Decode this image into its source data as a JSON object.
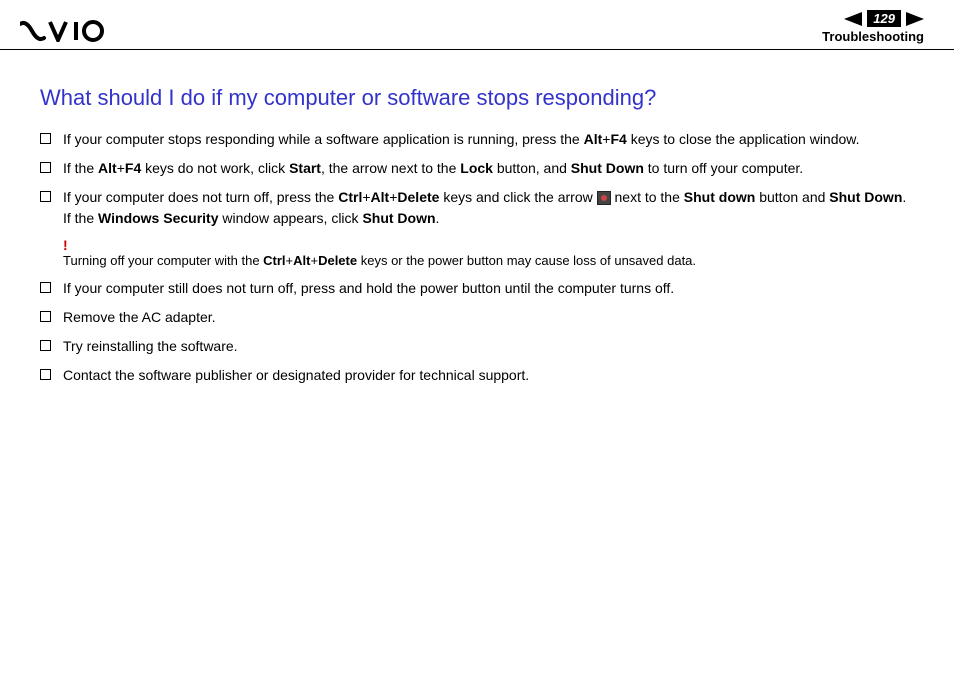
{
  "header": {
    "page_number": "129",
    "section": "Troubleshooting"
  },
  "title": "What should I do if my computer or software stops responding?",
  "bullets": [
    {
      "parts": [
        {
          "t": "If your computer stops responding while a software application is running, press the "
        },
        {
          "t": "Alt",
          "b": true
        },
        {
          "t": "+"
        },
        {
          "t": "F4",
          "b": true
        },
        {
          "t": " keys to close the application window."
        }
      ]
    },
    {
      "parts": [
        {
          "t": "If the "
        },
        {
          "t": "Alt",
          "b": true
        },
        {
          "t": "+"
        },
        {
          "t": "F4",
          "b": true
        },
        {
          "t": " keys do not work, click "
        },
        {
          "t": "Start",
          "b": true
        },
        {
          "t": ", the arrow next to the "
        },
        {
          "t": "Lock",
          "b": true
        },
        {
          "t": " button, and "
        },
        {
          "t": "Shut Down",
          "b": true
        },
        {
          "t": " to turn off your computer."
        }
      ]
    },
    {
      "parts": [
        {
          "t": "If your computer does not turn off, press the "
        },
        {
          "t": "Ctrl",
          "b": true
        },
        {
          "t": "+"
        },
        {
          "t": "Alt",
          "b": true
        },
        {
          "t": "+"
        },
        {
          "t": "Delete",
          "b": true
        },
        {
          "t": " keys and click the arrow "
        },
        {
          "icon": true
        },
        {
          "t": " next to the "
        },
        {
          "t": "Shut down",
          "b": true
        },
        {
          "t": " button and "
        },
        {
          "t": "Shut Down",
          "b": true
        },
        {
          "t": "."
        },
        {
          "br": true
        },
        {
          "t": "If the "
        },
        {
          "t": "Windows Security",
          "b": true
        },
        {
          "t": " window appears, click "
        },
        {
          "t": "Shut Down",
          "b": true
        },
        {
          "t": "."
        }
      ],
      "warning": {
        "mark": "!",
        "parts": [
          {
            "t": "Turning off your computer with the "
          },
          {
            "t": "Ctrl",
            "b": true
          },
          {
            "t": "+"
          },
          {
            "t": "Alt",
            "b": true
          },
          {
            "t": "+"
          },
          {
            "t": "Delete",
            "b": true
          },
          {
            "t": " keys or the power button may cause loss of unsaved data."
          }
        ]
      }
    },
    {
      "parts": [
        {
          "t": "If your computer still does not turn off, press and hold the power button until the computer turns off."
        }
      ]
    },
    {
      "parts": [
        {
          "t": "Remove the AC adapter."
        }
      ]
    },
    {
      "parts": [
        {
          "t": "Try reinstalling the software."
        }
      ]
    },
    {
      "parts": [
        {
          "t": "Contact the software publisher or designated provider for technical support."
        }
      ]
    }
  ]
}
